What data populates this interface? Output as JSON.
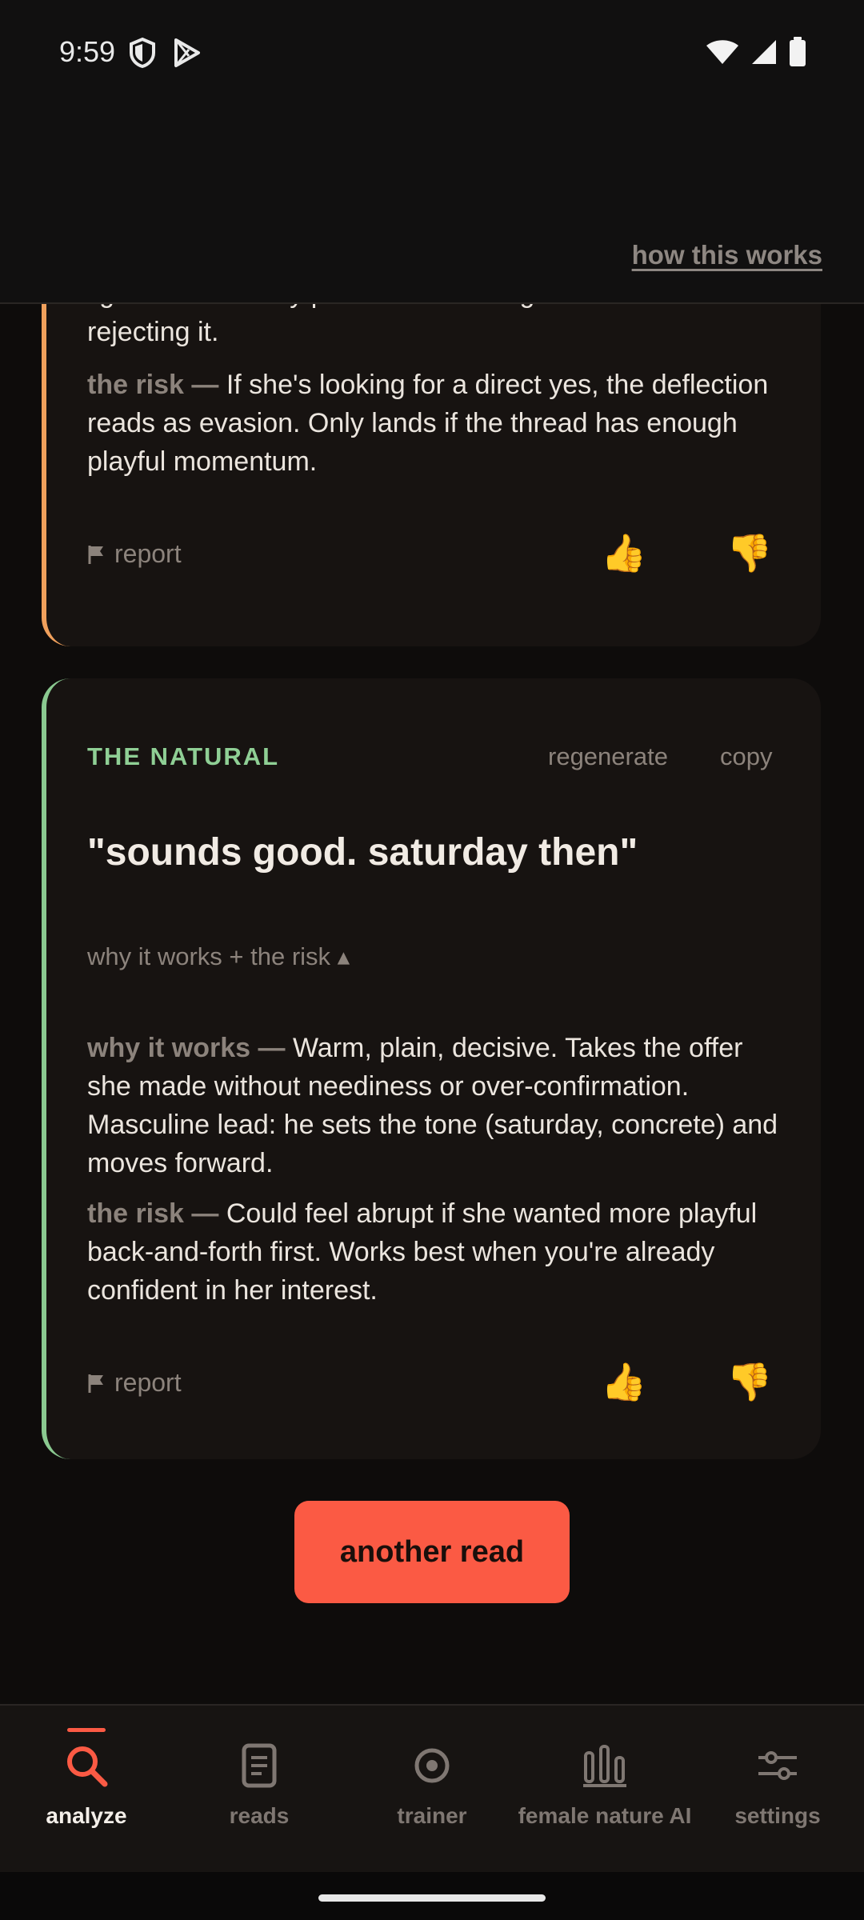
{
  "status": {
    "time": "9:59"
  },
  "header": {
    "how_link": "how this works"
  },
  "card1": {
    "partial_text": "light. Deflates any pressure in the logistics without rejecting it.",
    "risk_lead": "the risk —",
    "risk_text": " If she's looking for a direct yes, the deflection reads as evasion. Only lands if the thread has enough playful momentum.",
    "report_label": "report",
    "thumbs_up": "👍",
    "thumbs_down": "👎"
  },
  "card2": {
    "label": "THE NATURAL",
    "regenerate_label": "regenerate",
    "copy_label": "copy",
    "quote": "\"sounds good. saturday then\"",
    "toggle_label": "why it works + the risk ▴",
    "why_lead": "why it works —",
    "why_text": " Warm, plain, decisive. Takes the offer she made without neediness or over-confirmation. Masculine lead: he sets the tone (saturday, concrete) and moves forward.",
    "risk_lead": "the risk —",
    "risk_text": " Could feel abrupt if she wanted more playful back-and-forth first. Works best when you're already confident in her interest.",
    "report_label": "report",
    "thumbs_up": "👍",
    "thumbs_down": "👎"
  },
  "cta": {
    "label": "another read"
  },
  "nav": {
    "items": [
      {
        "label": "analyze",
        "icon": "search-icon",
        "active": true
      },
      {
        "label": "reads",
        "icon": "document-icon",
        "active": false
      },
      {
        "label": "trainer",
        "icon": "target-icon",
        "active": false
      },
      {
        "label": "female nature AI",
        "icon": "bars-icon",
        "active": false
      },
      {
        "label": "settings",
        "icon": "sliders-icon",
        "active": false
      }
    ]
  },
  "colors": {
    "accent": "#fb5a44",
    "card1_border": "#f0a05c",
    "card2_border": "#8ac990",
    "label_green": "#8fcf95"
  }
}
